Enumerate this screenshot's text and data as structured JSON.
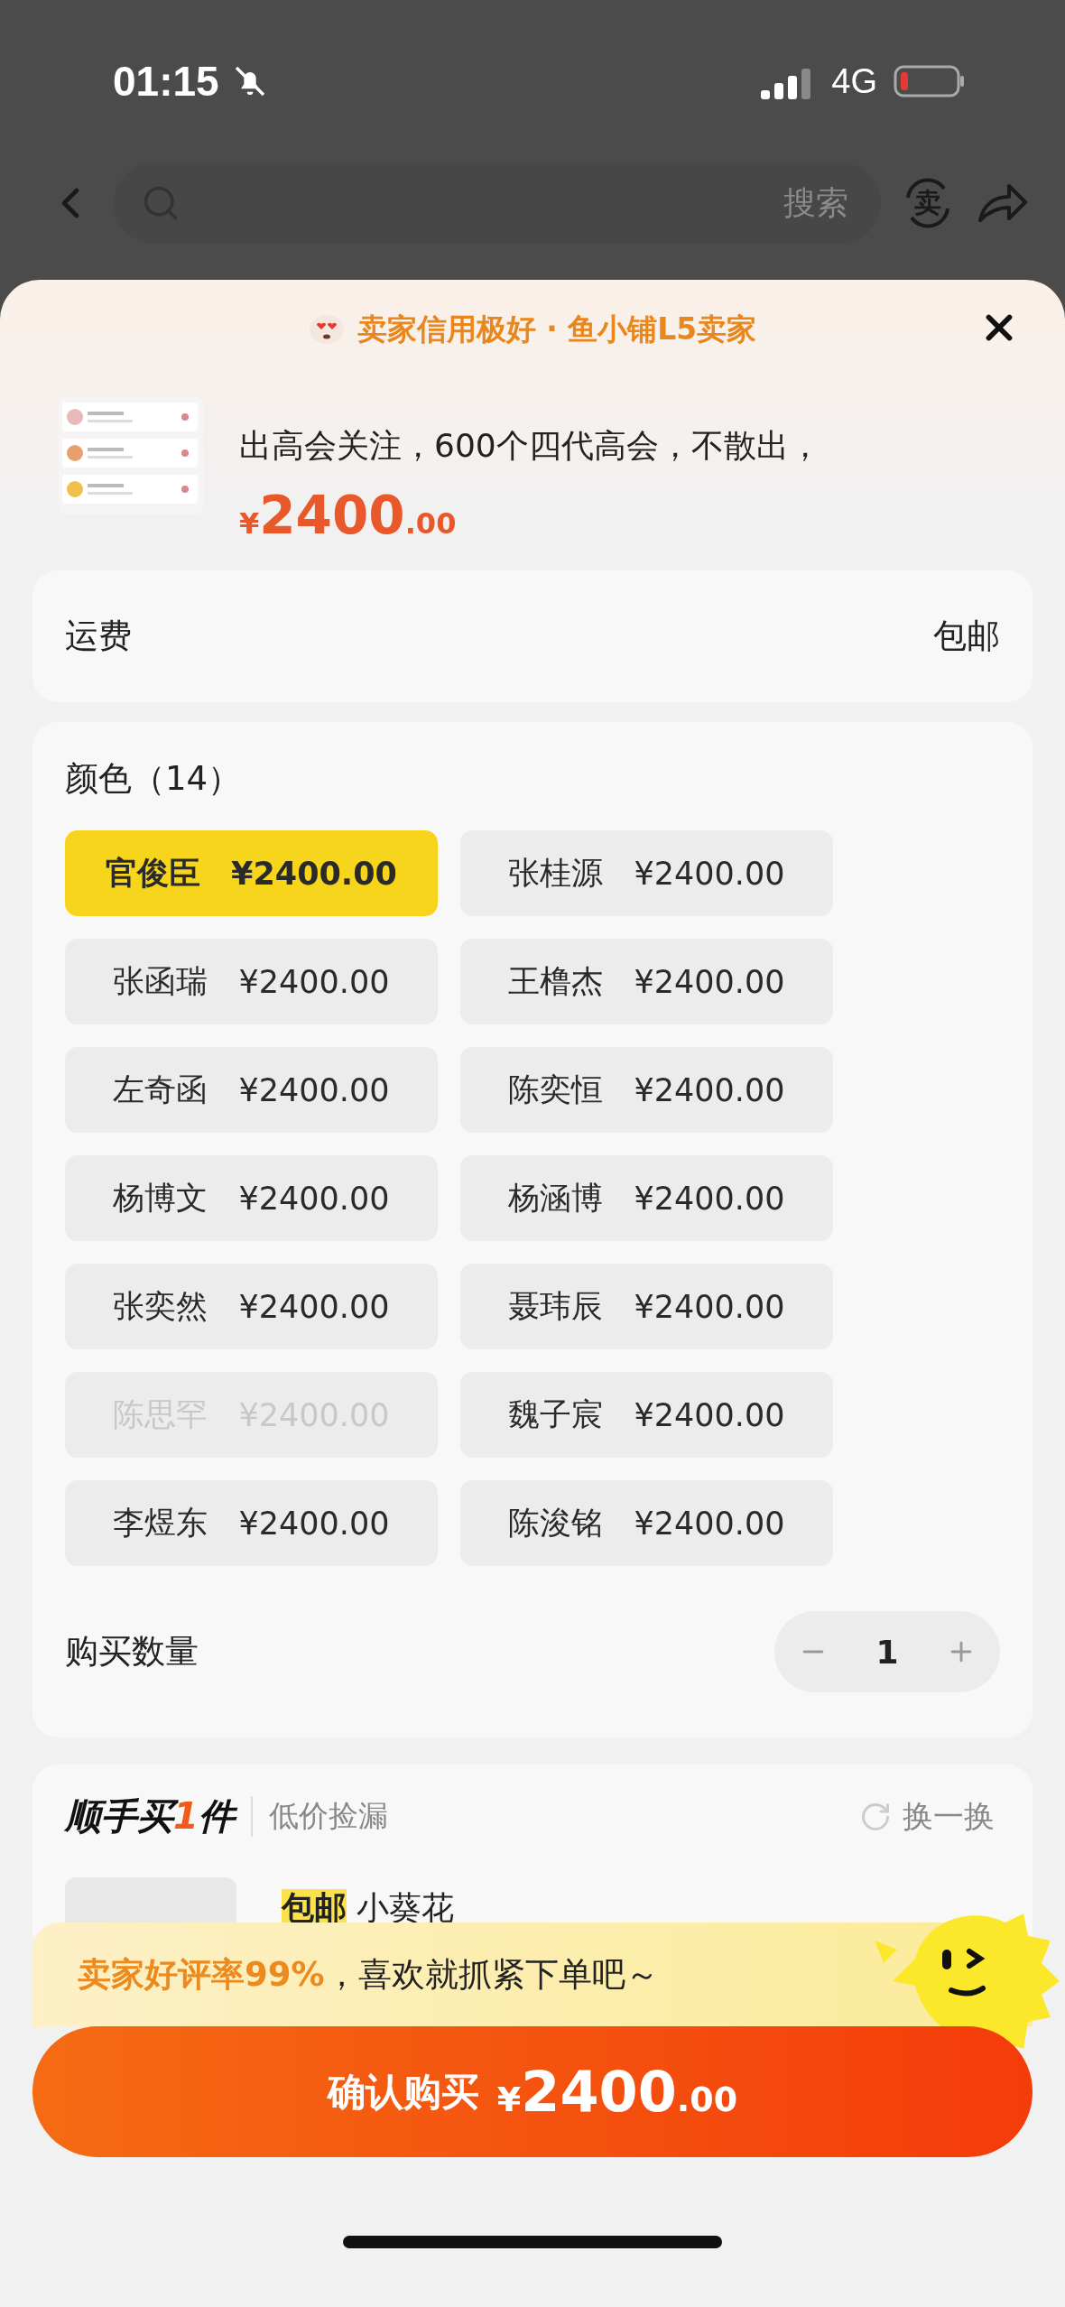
{
  "status_bar": {
    "time": "01:15",
    "network": "4G"
  },
  "nav": {
    "search_button": "搜索",
    "sell_glyph": "卖"
  },
  "sheet": {
    "banner": "卖家信用极好 · 鱼小铺L5卖家",
    "product": {
      "title": "出高会关注，600个四代高会，不散出，",
      "price_symbol": "¥",
      "price_int": "2400",
      "price_dec": ".00"
    },
    "shipping": {
      "label": "运费",
      "value": "包邮"
    },
    "colors": {
      "title": "颜色（14）",
      "options": [
        {
          "name": "官俊臣",
          "price": "¥2400.00",
          "selected": true,
          "disabled": false
        },
        {
          "name": "张桂源",
          "price": "¥2400.00",
          "selected": false,
          "disabled": false
        },
        {
          "name": "张函瑞",
          "price": "¥2400.00",
          "selected": false,
          "disabled": false
        },
        {
          "name": "王橹杰",
          "price": "¥2400.00",
          "selected": false,
          "disabled": false
        },
        {
          "name": "左奇函",
          "price": "¥2400.00",
          "selected": false,
          "disabled": false
        },
        {
          "name": "陈奕恒",
          "price": "¥2400.00",
          "selected": false,
          "disabled": false
        },
        {
          "name": "杨博文",
          "price": "¥2400.00",
          "selected": false,
          "disabled": false
        },
        {
          "name": "杨涵博",
          "price": "¥2400.00",
          "selected": false,
          "disabled": false
        },
        {
          "name": "张奕然",
          "price": "¥2400.00",
          "selected": false,
          "disabled": false
        },
        {
          "name": "聂玮辰",
          "price": "¥2400.00",
          "selected": false,
          "disabled": false
        },
        {
          "name": "陈思罕",
          "price": "¥2400.00",
          "selected": false,
          "disabled": true
        },
        {
          "name": "魏子宸",
          "price": "¥2400.00",
          "selected": false,
          "disabled": false
        },
        {
          "name": "李煜东",
          "price": "¥2400.00",
          "selected": false,
          "disabled": false
        },
        {
          "name": "陈浚铭",
          "price": "¥2400.00",
          "selected": false,
          "disabled": false
        }
      ]
    },
    "quantity": {
      "label": "购买数量",
      "value": "1"
    },
    "bundle": {
      "title_prefix": "顺手买",
      "title_count": "1",
      "title_suffix": "件",
      "subtitle": "低价捡漏",
      "refresh": "换一换",
      "item": {
        "tag": "包邮",
        "name": "小葵花"
      }
    },
    "promo": {
      "highlight": "卖家好评率99%",
      "text": "，喜欢就抓紧下单吧～"
    },
    "confirm": {
      "label": "确认购买",
      "price_symbol": "¥",
      "price_int": "2400",
      "price_dec": ".00"
    }
  }
}
